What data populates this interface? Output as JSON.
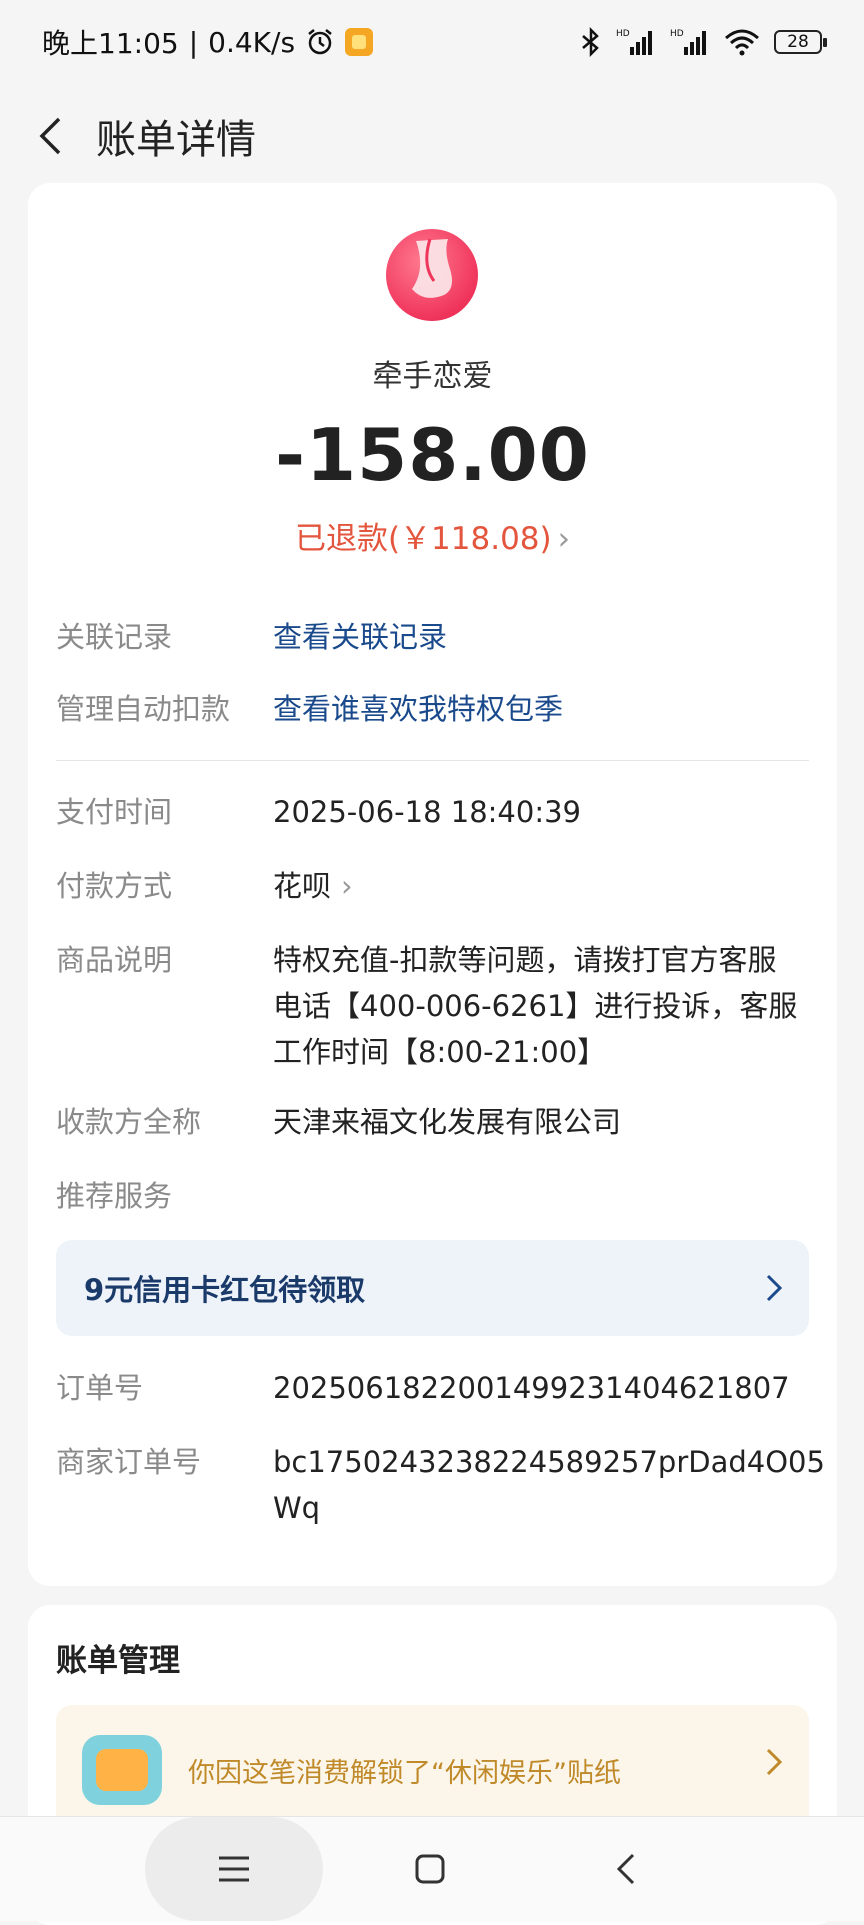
{
  "status_bar": {
    "time": "晚上11:05",
    "network_speed": "0.4K/s",
    "battery_level": "28",
    "icons": [
      "alarm-icon",
      "notification-icon",
      "bluetooth-icon",
      "signal-hd-icon",
      "signal-hd-icon",
      "wifi-icon",
      "battery-icon"
    ]
  },
  "header": {
    "title": "账单详情",
    "back_icon": "chevron-left-icon"
  },
  "bill": {
    "merchant_name": "牵手恋爱",
    "amount": "-158.00",
    "refund_text": "已退款(￥118.08)",
    "rows_top": [
      {
        "label": "关联记录",
        "value": "查看关联记录",
        "link": true
      },
      {
        "label": "管理自动扣款",
        "value": "查看谁喜欢我特权包季",
        "link": true
      }
    ],
    "pay_time": {
      "label": "支付时间",
      "value": "2025-06-18 18:40:39"
    },
    "pay_method": {
      "label": "付款方式",
      "value": "花呗"
    },
    "goods_desc": {
      "label": "商品说明",
      "line1": "特权充值-扣款等问题，请拨打官方客服",
      "line2": "电话【400-006-6261】进行投诉，客服",
      "line3": "工作时间【8:00-21:00】"
    },
    "payee": {
      "label": "收款方全称",
      "value": "天津来福文化发展有限公司"
    },
    "recommend_label": "推荐服务",
    "promo_text": "9元信用卡红包待领取",
    "order_no": {
      "label": "订单号",
      "value": "2025061822001499231404621807"
    },
    "merchant_order_no": {
      "label": "商家订单号",
      "line1": "bc1750243238224589257prDad4O05",
      "line2": "Wq"
    }
  },
  "bill_management": {
    "title": "账单管理",
    "sticker_text": "你因这笔消费解锁了“休闲娱乐”贴纸"
  },
  "nav": {
    "icons": [
      "menu-icon",
      "home-square-icon",
      "back-triangle-icon"
    ]
  },
  "colors": {
    "link": "#1a4a8c",
    "refund": "#e4553d",
    "background": "#f5f5f5"
  }
}
